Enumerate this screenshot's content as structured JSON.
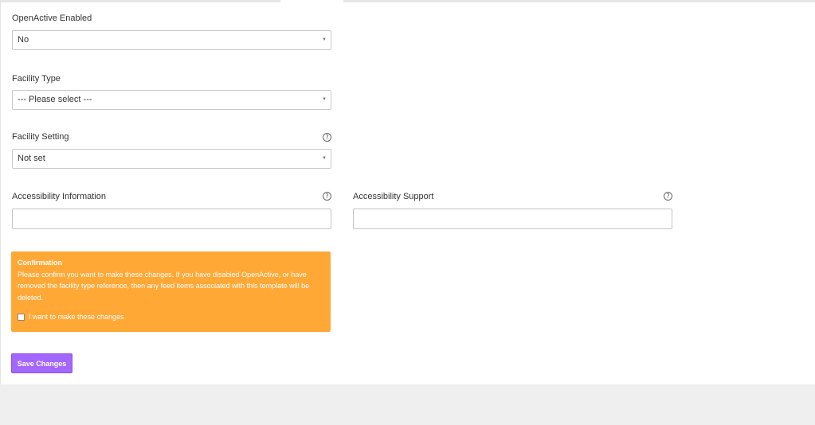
{
  "fields": {
    "openactive": {
      "label": "OpenActive Enabled",
      "value": "No"
    },
    "facility_type": {
      "label": "Facility Type",
      "value": "--- Please select ---"
    },
    "facility_setting": {
      "label": "Facility Setting",
      "value": "Not set",
      "help": "?"
    },
    "accessibility_info": {
      "label": "Accessibility Information",
      "value": "",
      "help": "?"
    },
    "accessibility_support": {
      "label": "Accessibility Support",
      "value": "",
      "help": "?"
    }
  },
  "confirmation": {
    "title": "Confirmation",
    "message": "Please confirm you want to make these changes. If you have disabled OpenActive, or have removed the facility type reference, then any feed items associated with this template will be deleted.",
    "checkbox_label": "I want to make these changes",
    "checked": false,
    "background": "#ffa836"
  },
  "actions": {
    "save_label": "Save Changes",
    "accent": "#a366ff"
  },
  "icons": {
    "dropdown": "chevron-down-icon",
    "help": "help-circle-icon"
  }
}
